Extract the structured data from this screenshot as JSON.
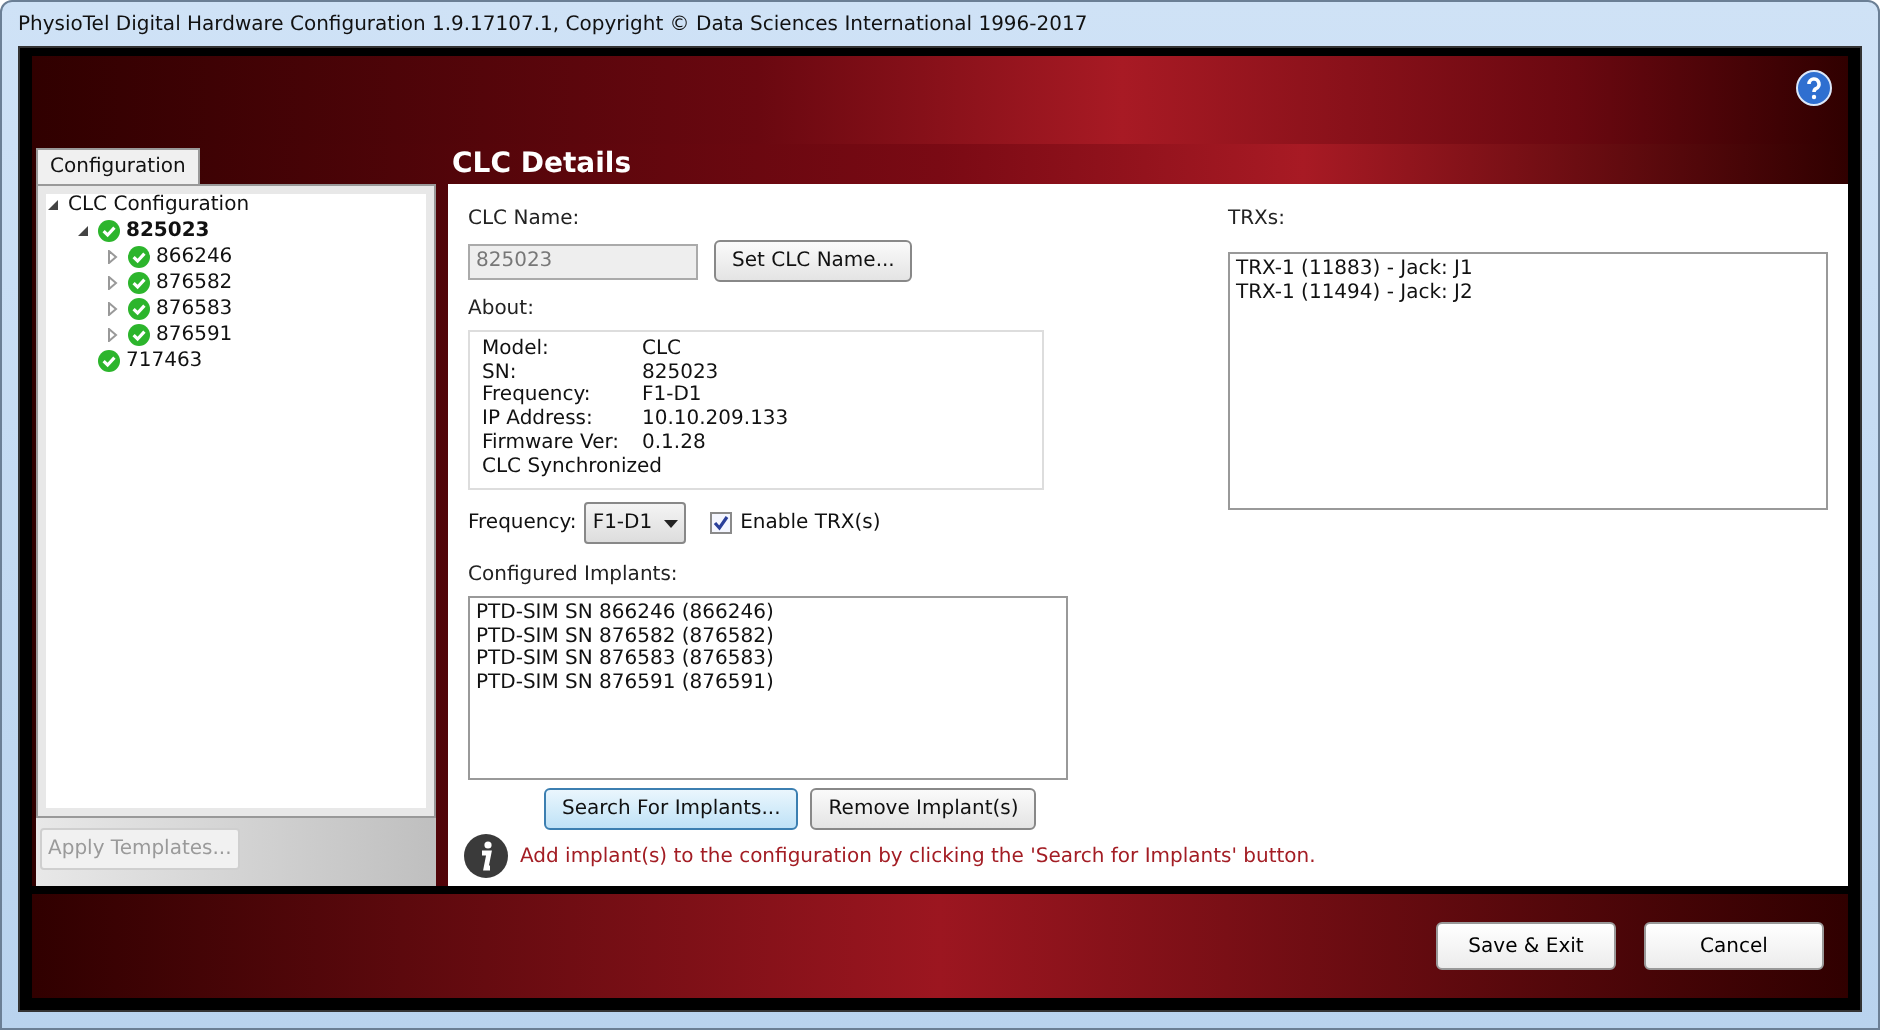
{
  "window": {
    "title": "PhysioTel Digital Hardware Configuration 1.9.17107.1, Copyright © Data Sciences International 1996-2017"
  },
  "tabs": [
    {
      "label": "Configuration",
      "selected": true
    }
  ],
  "tree": [
    {
      "label": "CLC Configuration",
      "expanded": true,
      "children": [
        {
          "label": "825023",
          "connected": true,
          "bold": true,
          "expanded": true,
          "children": [
            {
              "label": "866246",
              "connected": true,
              "expanded": false
            },
            {
              "label": "876582",
              "connected": true,
              "expanded": false
            },
            {
              "label": "876583",
              "connected": true,
              "expanded": false
            },
            {
              "label": "876591",
              "connected": true,
              "expanded": false
            }
          ]
        },
        {
          "label": "717463",
          "connected": true
        }
      ]
    }
  ],
  "apply_button": {
    "label": "Apply Templates...",
    "disabled": true
  },
  "details": {
    "title": "CLC Details",
    "name_label": "CLC Name:",
    "name_value": "825023",
    "set_name_button": "Set CLC Name...",
    "about_label": "About:",
    "about": [
      {
        "key": "Model:",
        "value": "CLC"
      },
      {
        "key": "SN:",
        "value": "825023"
      },
      {
        "key": "Frequency:",
        "value": "F1-D1"
      },
      {
        "key": "IP Address:",
        "value": "10.10.209.133"
      },
      {
        "key": "Firmware Ver:",
        "value": "0.1.28"
      }
    ],
    "about_note": "CLC Synchronized",
    "frequency_label": "Frequency:",
    "frequency_value": "F1-D1",
    "enable_trx": {
      "label": "Enable TRX(s)",
      "checked": true
    },
    "implants_label": "Configured Implants:",
    "implants": [
      "PTD-SIM SN 866246 (866246)",
      "PTD-SIM SN 876582 (876582)",
      "PTD-SIM SN 876583 (876583)",
      "PTD-SIM SN 876591 (876591)"
    ],
    "search_button": "Search For Implants...",
    "remove_button": "Remove Implant(s)",
    "info": "Add implant(s) to the configuration by clicking the 'Search for Implants' button.",
    "trx_label": "TRXs:",
    "trxs": [
      "TRX-1 (11883) - Jack: J1",
      "TRX-1 (11494) - Jack: J2"
    ]
  },
  "footer_buttons": [
    "Save & Exit",
    "Cancel"
  ]
}
